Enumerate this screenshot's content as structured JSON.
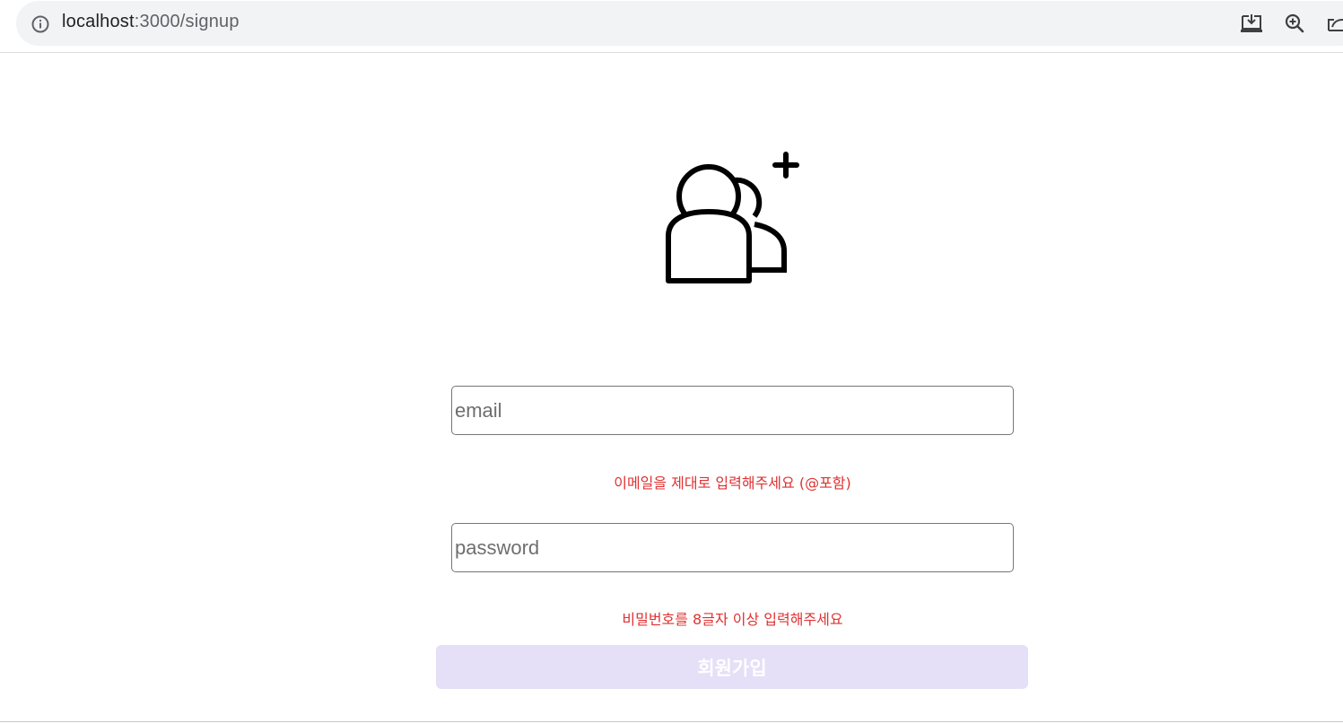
{
  "browser": {
    "url_host": "localhost",
    "url_path": ":3000/signup",
    "icons": [
      "info-icon",
      "install-app-icon",
      "zoom-icon",
      "share-icon"
    ]
  },
  "signup": {
    "hero_icon": "add-user-icon",
    "email_placeholder": "email",
    "email_value": "",
    "email_error": "이메일을 제대로 입력해주세요 (@포함)",
    "password_placeholder": "password",
    "password_value": "",
    "password_error": "비밀번호를 8글자 이상 입력해주세요",
    "submit_label": "회원가입"
  },
  "colors": {
    "error": "#e03131",
    "button_disabled_bg": "#e5dff7",
    "omnibox_bg": "#f1f3f4"
  }
}
